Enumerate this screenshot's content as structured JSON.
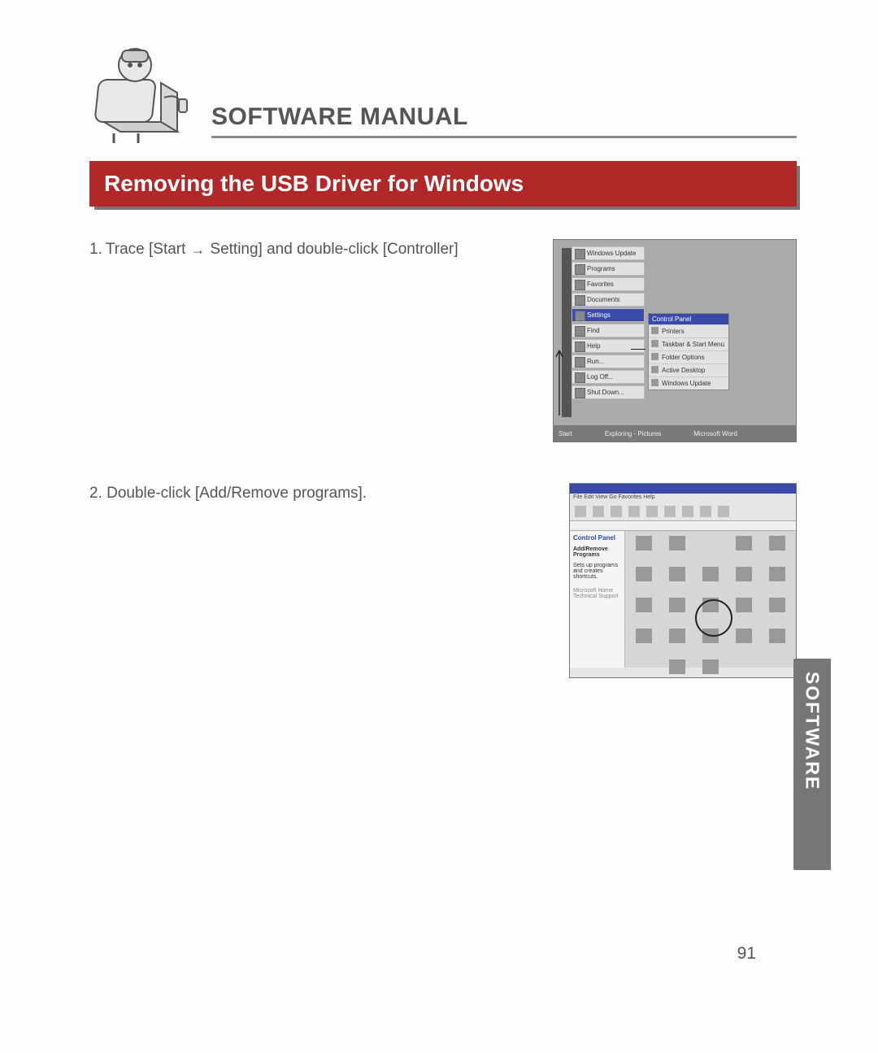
{
  "header": {
    "manual_title": "SOFTWARE MANUAL"
  },
  "section": {
    "title": "Removing the USB Driver for Windows"
  },
  "steps": {
    "s1_num": "1.",
    "s1_a": "Trace [Start",
    "s1_b": "Setting] and double-click [Controller]",
    "s2": "2. Double-click [Add/Remove programs]."
  },
  "screenshot1": {
    "items": [
      "Windows Update",
      "Programs",
      "Favorites",
      "Documents",
      "Settings",
      "Find",
      "Help",
      "Run...",
      "Log Off...",
      "Shut Down..."
    ],
    "submenu_header": "Control Panel",
    "submenu_items": [
      "Printers",
      "Taskbar & Start Menu",
      "Folder Options",
      "Active Desktop",
      "Windows Update"
    ],
    "taskbar": [
      "Start",
      "",
      "Exploring - Pictures",
      "Microsoft Word"
    ]
  },
  "screenshot2": {
    "menu": "File  Edit  View  Go  Favorites  Help",
    "side_title": "Control Panel",
    "side_text1": "Add/Remove Programs",
    "side_text2": "Sets up programs and creates shortcuts.",
    "side_text3": "Microsoft Home Technical Support"
  },
  "side_tab": "SOFTWARE",
  "page_number": "91"
}
